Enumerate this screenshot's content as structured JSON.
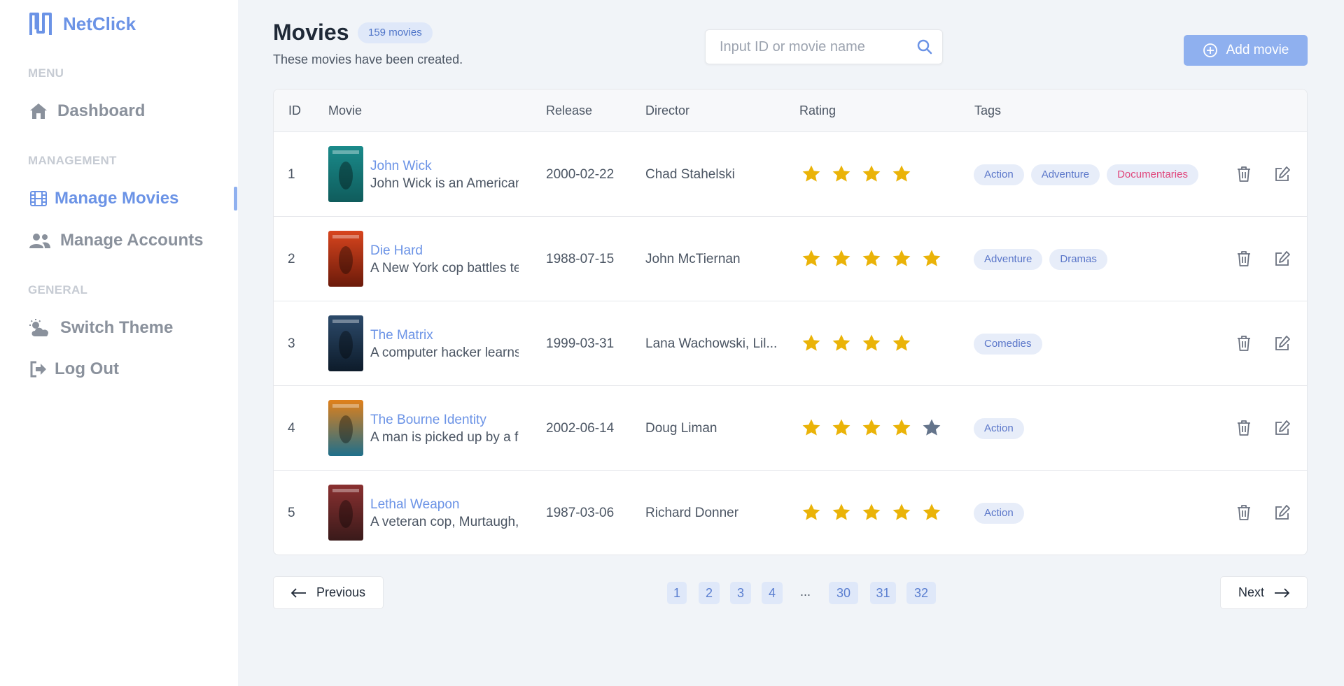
{
  "brand": {
    "name": "NetClick"
  },
  "sidebar": {
    "sections": [
      "MENU",
      "MANAGEMENT",
      "GENERAL"
    ],
    "items": [
      {
        "label": "Dashboard",
        "icon": "home-icon"
      },
      {
        "label": "Manage Movies",
        "icon": "film-icon",
        "active": true
      },
      {
        "label": "Manage Accounts",
        "icon": "users-icon"
      },
      {
        "label": "Switch Theme",
        "icon": "theme-icon"
      },
      {
        "label": "Log Out",
        "icon": "logout-icon"
      }
    ]
  },
  "header": {
    "title": "Movies",
    "count_badge": "159 movies",
    "subtitle": "These movies have been created.",
    "search_placeholder": "Input ID or movie name",
    "add_button": "Add movie"
  },
  "table": {
    "columns": [
      "ID",
      "Movie",
      "Release",
      "Director",
      "Rating",
      "Tags"
    ],
    "rows": [
      {
        "id": "1",
        "title": "John Wick",
        "desc": "John Wick is an American",
        "release": "2000-02-22",
        "director": "Chad Stahelski",
        "rating": 4,
        "max_stars": 4,
        "tags": [
          {
            "label": "Action"
          },
          {
            "label": "Adventure"
          },
          {
            "label": "Documentaries",
            "color": "#e0457b"
          }
        ]
      },
      {
        "id": "2",
        "title": "Die Hard",
        "desc": "A New York cop battles te",
        "release": "1988-07-15",
        "director": "John McTiernan",
        "rating": 5,
        "max_stars": 5,
        "tags": [
          {
            "label": "Adventure"
          },
          {
            "label": "Dramas"
          }
        ]
      },
      {
        "id": "3",
        "title": "The Matrix",
        "desc": "A computer hacker learns",
        "release": "1999-03-31",
        "director": "Lana Wachowski, Lil...",
        "rating": 4,
        "max_stars": 4,
        "tags": [
          {
            "label": "Comedies"
          }
        ]
      },
      {
        "id": "4",
        "title": "The Bourne Identity",
        "desc": "A man is picked up by a fi",
        "release": "2002-06-14",
        "director": "Doug Liman",
        "rating": 4,
        "max_stars": 5,
        "tags": [
          {
            "label": "Action"
          }
        ]
      },
      {
        "id": "5",
        "title": "Lethal Weapon",
        "desc": "A veteran cop, Murtaugh,",
        "release": "1987-03-06",
        "director": "Richard Donner",
        "rating": 5,
        "max_stars": 5,
        "tags": [
          {
            "label": "Action"
          }
        ]
      }
    ]
  },
  "pagination": {
    "previous": "Previous",
    "next": "Next",
    "pages": [
      "1",
      "2",
      "3",
      "4",
      "...",
      "30",
      "31",
      "32"
    ]
  },
  "colors": {
    "accent": "#6b93e6",
    "star_filled": "#eab308",
    "star_empty": "#64748b",
    "pink_tag": "#e0457b"
  }
}
